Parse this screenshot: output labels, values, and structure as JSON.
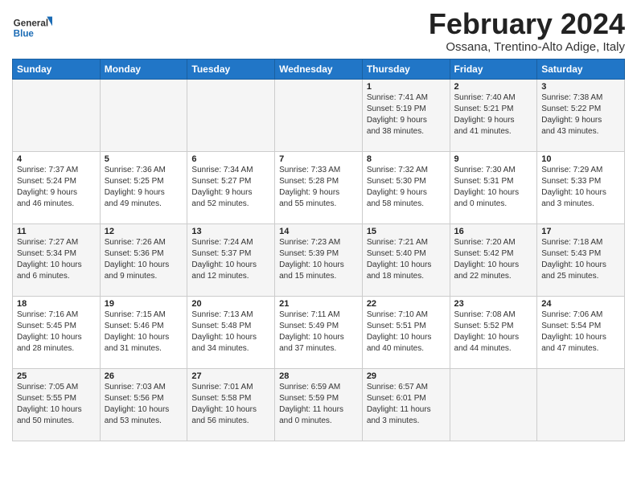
{
  "logo": {
    "line1": "General",
    "line2": "Blue"
  },
  "title": "February 2024",
  "location": "Ossana, Trentino-Alto Adige, Italy",
  "days_of_week": [
    "Sunday",
    "Monday",
    "Tuesday",
    "Wednesday",
    "Thursday",
    "Friday",
    "Saturday"
  ],
  "weeks": [
    [
      {
        "day": "",
        "info": ""
      },
      {
        "day": "",
        "info": ""
      },
      {
        "day": "",
        "info": ""
      },
      {
        "day": "",
        "info": ""
      },
      {
        "day": "1",
        "info": "Sunrise: 7:41 AM\nSunset: 5:19 PM\nDaylight: 9 hours\nand 38 minutes."
      },
      {
        "day": "2",
        "info": "Sunrise: 7:40 AM\nSunset: 5:21 PM\nDaylight: 9 hours\nand 41 minutes."
      },
      {
        "day": "3",
        "info": "Sunrise: 7:38 AM\nSunset: 5:22 PM\nDaylight: 9 hours\nand 43 minutes."
      }
    ],
    [
      {
        "day": "4",
        "info": "Sunrise: 7:37 AM\nSunset: 5:24 PM\nDaylight: 9 hours\nand 46 minutes."
      },
      {
        "day": "5",
        "info": "Sunrise: 7:36 AM\nSunset: 5:25 PM\nDaylight: 9 hours\nand 49 minutes."
      },
      {
        "day": "6",
        "info": "Sunrise: 7:34 AM\nSunset: 5:27 PM\nDaylight: 9 hours\nand 52 minutes."
      },
      {
        "day": "7",
        "info": "Sunrise: 7:33 AM\nSunset: 5:28 PM\nDaylight: 9 hours\nand 55 minutes."
      },
      {
        "day": "8",
        "info": "Sunrise: 7:32 AM\nSunset: 5:30 PM\nDaylight: 9 hours\nand 58 minutes."
      },
      {
        "day": "9",
        "info": "Sunrise: 7:30 AM\nSunset: 5:31 PM\nDaylight: 10 hours\nand 0 minutes."
      },
      {
        "day": "10",
        "info": "Sunrise: 7:29 AM\nSunset: 5:33 PM\nDaylight: 10 hours\nand 3 minutes."
      }
    ],
    [
      {
        "day": "11",
        "info": "Sunrise: 7:27 AM\nSunset: 5:34 PM\nDaylight: 10 hours\nand 6 minutes."
      },
      {
        "day": "12",
        "info": "Sunrise: 7:26 AM\nSunset: 5:36 PM\nDaylight: 10 hours\nand 9 minutes."
      },
      {
        "day": "13",
        "info": "Sunrise: 7:24 AM\nSunset: 5:37 PM\nDaylight: 10 hours\nand 12 minutes."
      },
      {
        "day": "14",
        "info": "Sunrise: 7:23 AM\nSunset: 5:39 PM\nDaylight: 10 hours\nand 15 minutes."
      },
      {
        "day": "15",
        "info": "Sunrise: 7:21 AM\nSunset: 5:40 PM\nDaylight: 10 hours\nand 18 minutes."
      },
      {
        "day": "16",
        "info": "Sunrise: 7:20 AM\nSunset: 5:42 PM\nDaylight: 10 hours\nand 22 minutes."
      },
      {
        "day": "17",
        "info": "Sunrise: 7:18 AM\nSunset: 5:43 PM\nDaylight: 10 hours\nand 25 minutes."
      }
    ],
    [
      {
        "day": "18",
        "info": "Sunrise: 7:16 AM\nSunset: 5:45 PM\nDaylight: 10 hours\nand 28 minutes."
      },
      {
        "day": "19",
        "info": "Sunrise: 7:15 AM\nSunset: 5:46 PM\nDaylight: 10 hours\nand 31 minutes."
      },
      {
        "day": "20",
        "info": "Sunrise: 7:13 AM\nSunset: 5:48 PM\nDaylight: 10 hours\nand 34 minutes."
      },
      {
        "day": "21",
        "info": "Sunrise: 7:11 AM\nSunset: 5:49 PM\nDaylight: 10 hours\nand 37 minutes."
      },
      {
        "day": "22",
        "info": "Sunrise: 7:10 AM\nSunset: 5:51 PM\nDaylight: 10 hours\nand 40 minutes."
      },
      {
        "day": "23",
        "info": "Sunrise: 7:08 AM\nSunset: 5:52 PM\nDaylight: 10 hours\nand 44 minutes."
      },
      {
        "day": "24",
        "info": "Sunrise: 7:06 AM\nSunset: 5:54 PM\nDaylight: 10 hours\nand 47 minutes."
      }
    ],
    [
      {
        "day": "25",
        "info": "Sunrise: 7:05 AM\nSunset: 5:55 PM\nDaylight: 10 hours\nand 50 minutes."
      },
      {
        "day": "26",
        "info": "Sunrise: 7:03 AM\nSunset: 5:56 PM\nDaylight: 10 hours\nand 53 minutes."
      },
      {
        "day": "27",
        "info": "Sunrise: 7:01 AM\nSunset: 5:58 PM\nDaylight: 10 hours\nand 56 minutes."
      },
      {
        "day": "28",
        "info": "Sunrise: 6:59 AM\nSunset: 5:59 PM\nDaylight: 11 hours\nand 0 minutes."
      },
      {
        "day": "29",
        "info": "Sunrise: 6:57 AM\nSunset: 6:01 PM\nDaylight: 11 hours\nand 3 minutes."
      },
      {
        "day": "",
        "info": ""
      },
      {
        "day": "",
        "info": ""
      }
    ]
  ]
}
